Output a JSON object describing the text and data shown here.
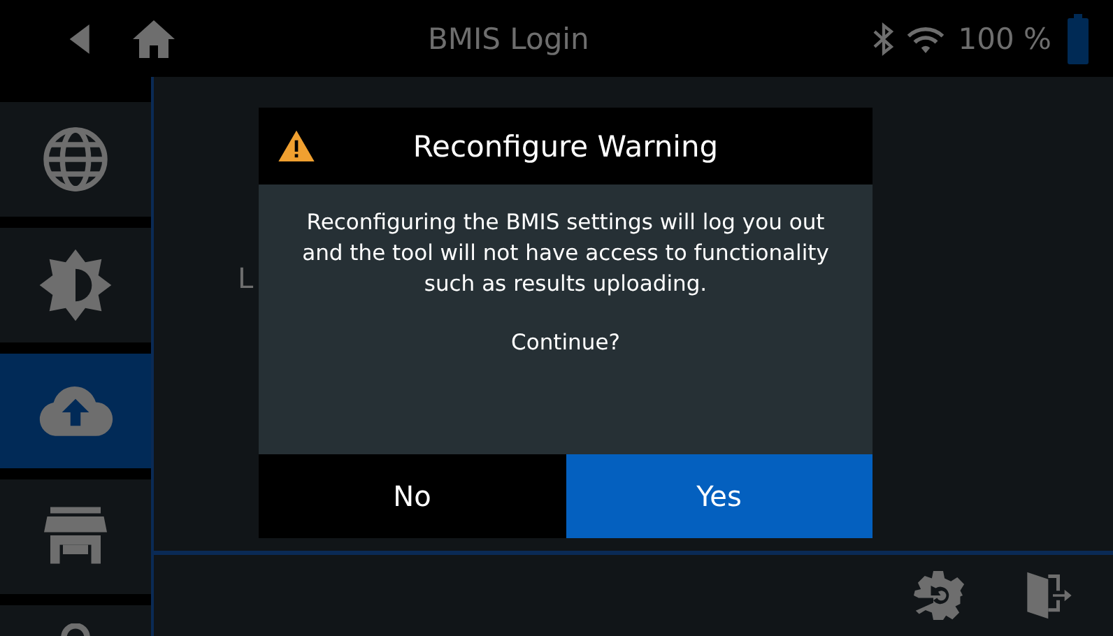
{
  "top_bar": {
    "title": "BMIS Login",
    "battery": "100 %"
  },
  "sidebar": {
    "items": [
      {
        "selected": false
      },
      {
        "selected": false
      },
      {
        "selected": true
      },
      {
        "selected": false
      },
      {
        "selected": false
      }
    ]
  },
  "background_label": "L",
  "dialog": {
    "title": "Reconfigure Warning",
    "message": "Reconfiguring the BMIS settings will log you out and the tool will not have access to functionality such as results uploading.",
    "question": "Continue?",
    "buttons": [
      {
        "label": "No",
        "selected": false
      },
      {
        "label": "Yes",
        "selected": true
      }
    ]
  }
}
